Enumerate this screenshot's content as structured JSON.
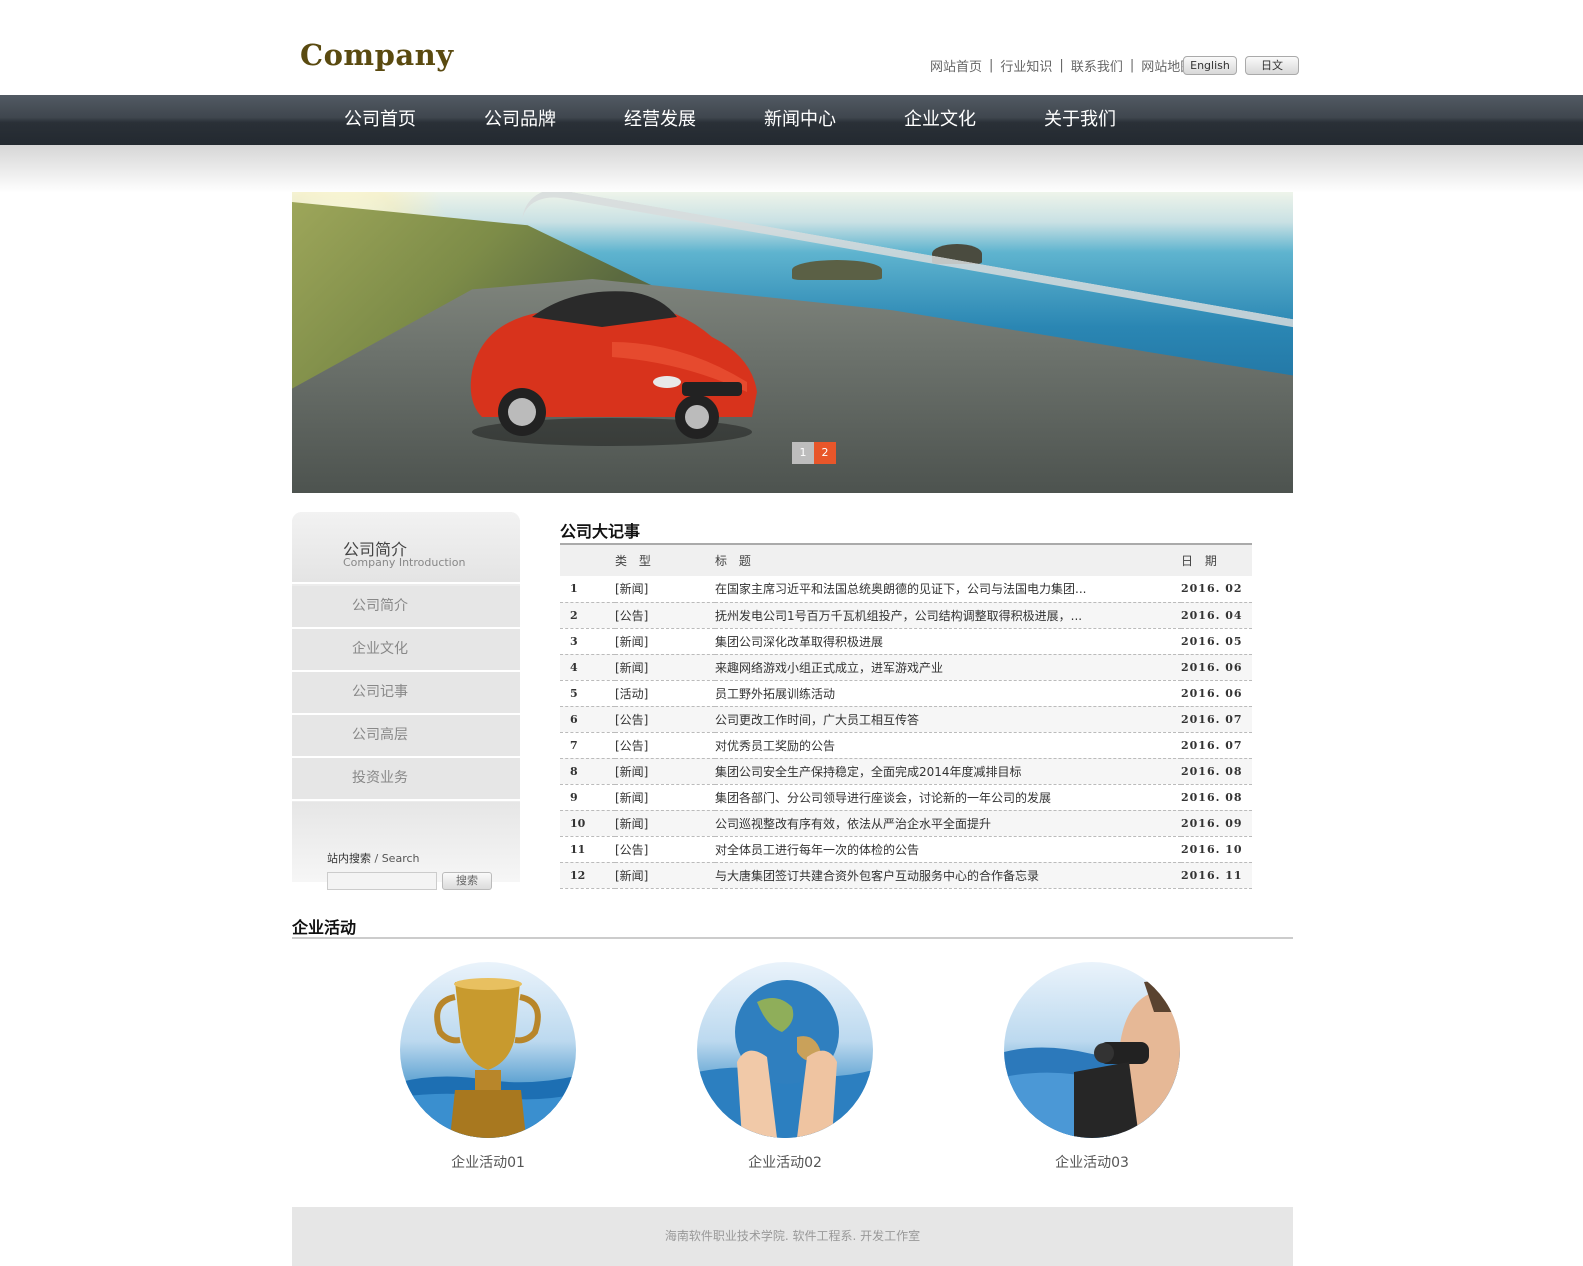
{
  "header": {
    "logo": "Company",
    "links": [
      "网站首页",
      "行业知识",
      "联系我们",
      "网站地图"
    ],
    "lang_english": "English",
    "lang_japanese": "日文"
  },
  "nav": [
    "公司首页",
    "公司品牌",
    "经营发展",
    "新闻中心",
    "企业文化",
    "关于我们"
  ],
  "banner": {
    "pages": [
      "1",
      "2"
    ],
    "active_page": 2
  },
  "sidebar": {
    "title": "公司简介",
    "subtitle": "Company Introduction",
    "items": [
      "公司简介",
      "企业文化",
      "公司记事",
      "公司高层",
      "投资业务"
    ],
    "search_label": "站内搜索",
    "search_label_en": "/ Search",
    "search_button": "搜索"
  },
  "events": {
    "title": "公司大记事",
    "columns": [
      "类 型",
      "标 题",
      "日 期"
    ],
    "rows": [
      {
        "num": "1",
        "type": "[新闻]",
        "title": "在国家主席习近平和法国总统奥朗德的见证下，公司与法国电力集团...",
        "date": "2016. 02"
      },
      {
        "num": "2",
        "type": "[公告]",
        "title": "抚州发电公司1号百万千瓦机组投产，公司结构调整取得积极进展，...",
        "date": "2016. 04"
      },
      {
        "num": "3",
        "type": "[新闻]",
        "title": "集团公司深化改革取得积极进展",
        "date": "2016. 05"
      },
      {
        "num": "4",
        "type": "[新闻]",
        "title": "来趣网络游戏小组正式成立，进军游戏产业",
        "date": "2016. 06"
      },
      {
        "num": "5",
        "type": "[活动]",
        "title": "员工野外拓展训练活动",
        "date": "2016. 06"
      },
      {
        "num": "6",
        "type": "[公告]",
        "title": "公司更改工作时间，广大员工相互传答",
        "date": "2016. 07"
      },
      {
        "num": "7",
        "type": "[公告]",
        "title": "对优秀员工奖励的公告",
        "date": "2016. 07"
      },
      {
        "num": "8",
        "type": "[新闻]",
        "title": "集团公司安全生产保持稳定，全面完成2014年度减排目标",
        "date": "2016. 08"
      },
      {
        "num": "9",
        "type": "[新闻]",
        "title": "集团各部门、分公司领导进行座谈会，讨论新的一年公司的发展",
        "date": "2016. 08"
      },
      {
        "num": "10",
        "type": "[新闻]",
        "title": "公司巡视整改有序有效，依法从严治企水平全面提升",
        "date": "2016. 09"
      },
      {
        "num": "11",
        "type": "[公告]",
        "title": "对全体员工进行每年一次的体检的公告",
        "date": "2016. 10"
      },
      {
        "num": "12",
        "type": "[新闻]",
        "title": "与大唐集团签订共建合资外包客户互动服务中心的合作备忘录",
        "date": "2016. 11"
      }
    ]
  },
  "activities": {
    "title": "企业活动",
    "items": [
      {
        "label": "企业活动01",
        "icon": "trophy-image"
      },
      {
        "label": "企业活动02",
        "icon": "globe-hands-image"
      },
      {
        "label": "企业活动03",
        "icon": "binoculars-image"
      }
    ]
  },
  "footer": {
    "text": "海南软件职业技术学院. 软件工程系. 开发工作室"
  },
  "colors": {
    "accent": "#e8562a",
    "nav_bg": "#2f363d",
    "logo": "#5a4a10"
  }
}
